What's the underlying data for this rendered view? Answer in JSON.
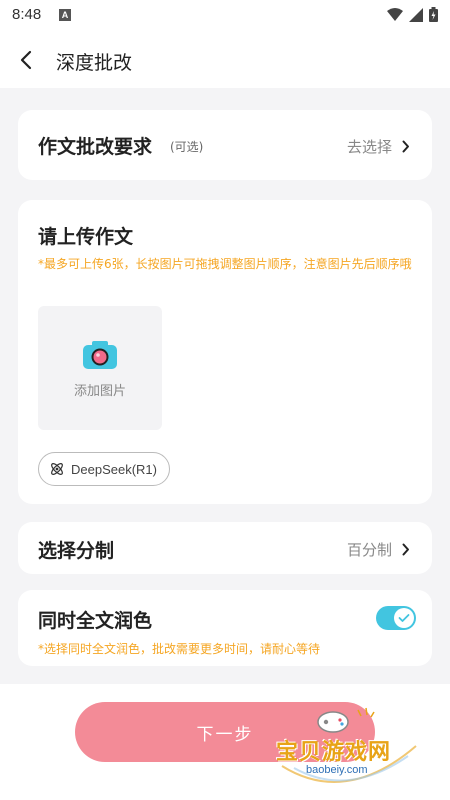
{
  "status": {
    "time": "8:48",
    "notification_letter": "A"
  },
  "nav": {
    "title": "深度批改"
  },
  "requirements": {
    "title": "作文批改要求",
    "optional": "(可选)",
    "action": "去选择"
  },
  "upload": {
    "title": "请上传作文",
    "note": "*最多可上传6张，长按图片可拖拽调整图片顺序，注意图片先后顺序哦",
    "add_label": "添加图片",
    "model": "DeepSeek(R1)"
  },
  "grading": {
    "title": "选择分制",
    "value": "百分制"
  },
  "polish": {
    "title": "同时全文润色",
    "note": "*选择同时全文润色，批改需要更多时间，请耐心等待",
    "enabled": true
  },
  "bottom": {
    "next_label": "下一步"
  },
  "watermark": {
    "title": "宝贝游戏网",
    "url": "baobeiy.com"
  },
  "colors": {
    "accent": "#42c5e0",
    "button": "#f38b97",
    "note": "#f5a623"
  }
}
